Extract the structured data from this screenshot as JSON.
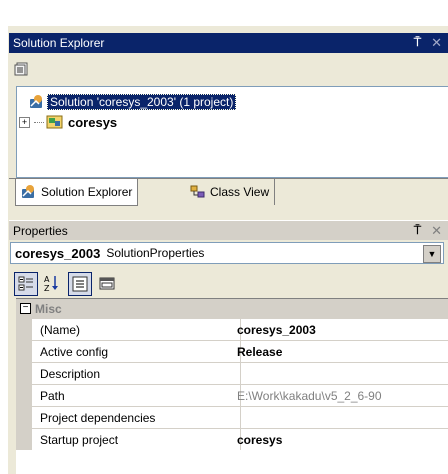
{
  "solution_explorer": {
    "title": "Solution Explorer",
    "pin_glyph": "⍑",
    "close_glyph": "✕",
    "tree": {
      "solution_label": "Solution 'coresys_2003' (1 project)",
      "project_label": "coresys",
      "expander_glyph": "+"
    },
    "tabs": [
      {
        "label": "Solution Explorer",
        "active": true
      },
      {
        "label": "Class View",
        "active": false
      }
    ]
  },
  "properties": {
    "title": "Properties",
    "pin_glyph": "⍑",
    "close_glyph": "✕",
    "object": {
      "name": "coresys_2003",
      "type": "SolutionProperties",
      "dropdown_glyph": "▼"
    },
    "category": {
      "label": "Misc",
      "collapse_glyph": "−"
    },
    "rows": [
      {
        "name": "(Name)",
        "value": "coresys_2003",
        "bold": true,
        "gray": false
      },
      {
        "name": "Active config",
        "value": "Release",
        "bold": true,
        "gray": false
      },
      {
        "name": "Description",
        "value": "",
        "bold": false,
        "gray": false
      },
      {
        "name": "Path",
        "value": "E:\\Work\\kakadu\\v5_2_6-90",
        "bold": false,
        "gray": true
      },
      {
        "name": "Project dependencies",
        "value": "",
        "bold": false,
        "gray": false
      },
      {
        "name": "Startup project",
        "value": "coresys",
        "bold": true,
        "gray": false
      }
    ]
  },
  "colors": {
    "titlebar_active": "#0a246a",
    "chrome": "#ece9d8",
    "selection": "#0a246a"
  }
}
